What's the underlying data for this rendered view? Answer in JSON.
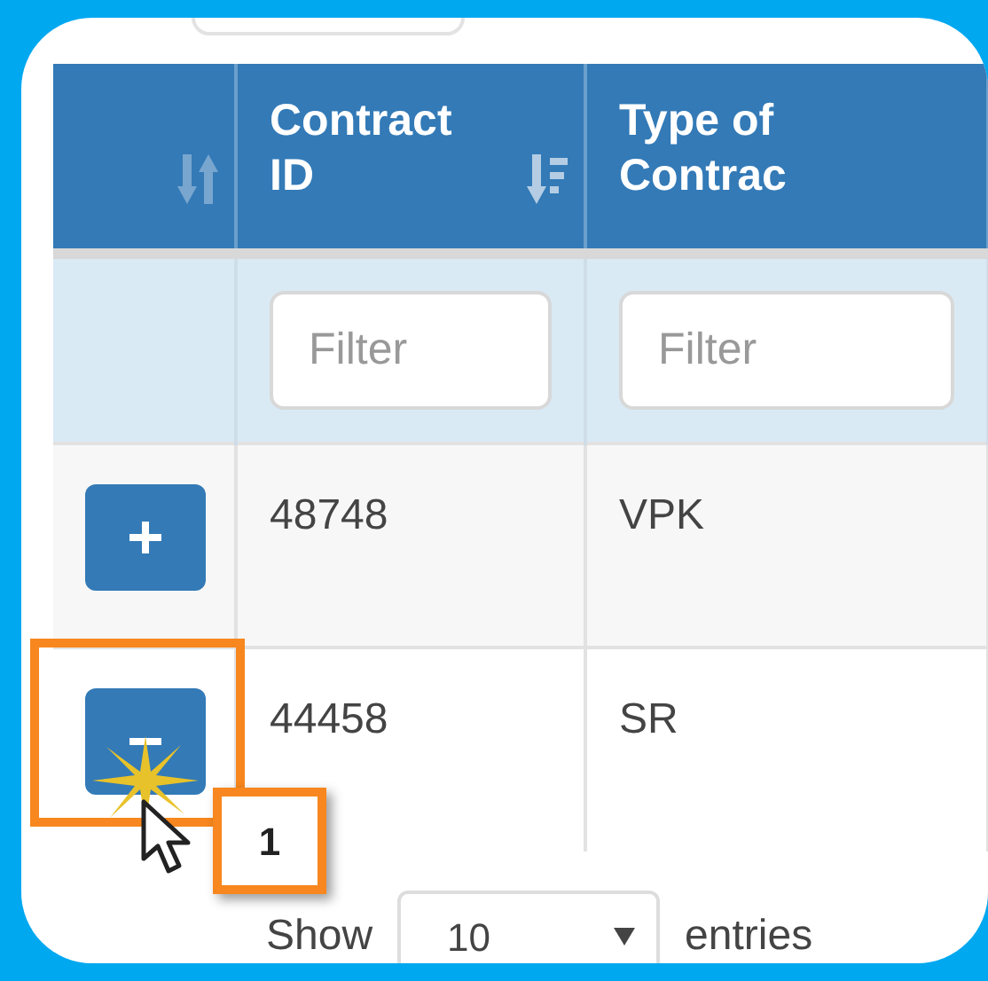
{
  "columns": [
    {
      "kind": "control",
      "sorted": false
    },
    {
      "kind": "text",
      "label": "Contract ID",
      "sorted": true
    },
    {
      "kind": "text",
      "label": "Type of Contrac"
    }
  ],
  "filters": [
    {
      "placeholder": "Filter"
    },
    {
      "placeholder": "Filter"
    }
  ],
  "rows": [
    {
      "expanded": false,
      "highlighted": false,
      "contract_id": "48748",
      "type": "VPK"
    },
    {
      "expanded": true,
      "highlighted": true,
      "contract_id": "44458",
      "type": "SR"
    }
  ],
  "callout": {
    "step": "1"
  },
  "footer": {
    "show_label": "Show",
    "page_size": "10",
    "entries_label": "entries"
  }
}
